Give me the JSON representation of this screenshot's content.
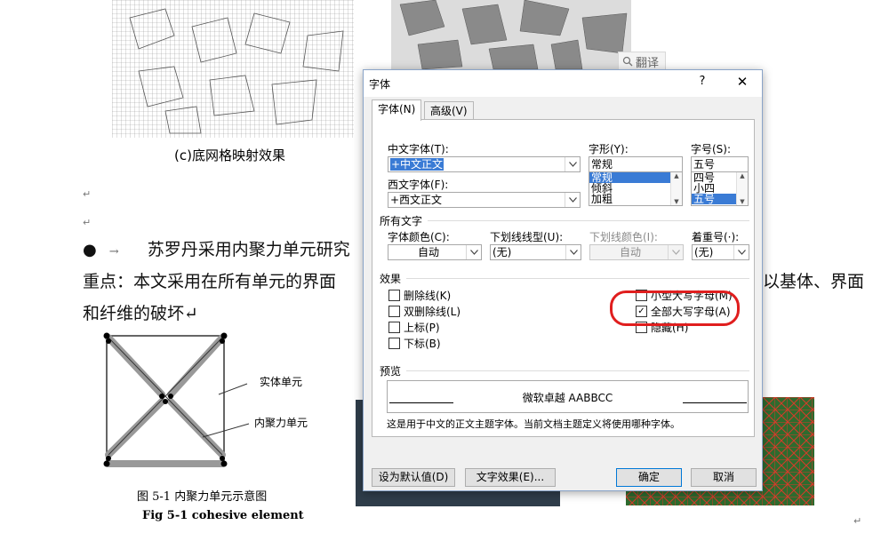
{
  "document": {
    "caption_c": "(c)底网格映射效果",
    "para_mark": "↵",
    "bullet": "●",
    "bullet_arrow": "→",
    "line1": "苏罗丹采用内聚力单元研究",
    "line2": "重点：本文采用在所有单元的界面",
    "line2_right": "以基体、界面",
    "line3": "和纤维的破坏↵",
    "fig_label_solid": "实体单元",
    "fig_label_cohesive": "内聚力单元",
    "fig_caption_cn": "图 5-1  内聚力单元示意图",
    "fig_caption_en": "Fig 5-1 cohesive element",
    "translate_label": "翻译"
  },
  "dialog": {
    "title": "字体",
    "help": "?",
    "close": "✕",
    "tabs": [
      {
        "label": "字体(N)",
        "active": true
      },
      {
        "label": "高级(V)",
        "active": false
      }
    ],
    "cn_font": {
      "label": "中文字体(T):",
      "value": "+中文正文"
    },
    "west_font": {
      "label": "西文字体(F):",
      "value": "+西文正文"
    },
    "style": {
      "label": "字形(Y):",
      "value": "常规",
      "options": [
        "常规",
        "倾斜",
        "加粗"
      ],
      "selected": "常规"
    },
    "size": {
      "label": "字号(S):",
      "value": "五号",
      "options": [
        "四号",
        "小四",
        "五号"
      ],
      "selected": "五号"
    },
    "all_text": {
      "group": "所有文字",
      "font_color": {
        "label": "字体颜色(C):",
        "value": "自动"
      },
      "underline_type": {
        "label": "下划线线型(U):",
        "value": "(无)"
      },
      "underline_color": {
        "label": "下划线颜色(I):",
        "value": "自动"
      },
      "emphasis": {
        "label": "着重号(·):",
        "value": "(无)"
      }
    },
    "effects": {
      "group": "效果",
      "strikethrough": {
        "label": "删除线(K)",
        "checked": false
      },
      "double_strikethrough": {
        "label": "双删除线(L)",
        "checked": false
      },
      "superscript": {
        "label": "上标(P)",
        "checked": false
      },
      "subscript": {
        "label": "下标(B)",
        "checked": false
      },
      "small_caps": {
        "label": "小型大写字母(M)",
        "checked": false
      },
      "all_caps": {
        "label": "全部大写字母(A)",
        "checked": true
      },
      "hidden": {
        "label": "隐藏(H)",
        "checked": false
      }
    },
    "preview": {
      "group": "预览",
      "sample": "微软卓越  AABBCC",
      "note": "这是用于中文的正文主题字体。当前文档主题定义将使用哪种字体。"
    },
    "buttons": {
      "set_default": "设为默认值(D)",
      "text_effects": "文字效果(E)...",
      "ok": "确定",
      "cancel": "取消"
    }
  },
  "colors": {
    "highlight_ring": "#e01e1e",
    "selection": "#3a7bd5"
  }
}
